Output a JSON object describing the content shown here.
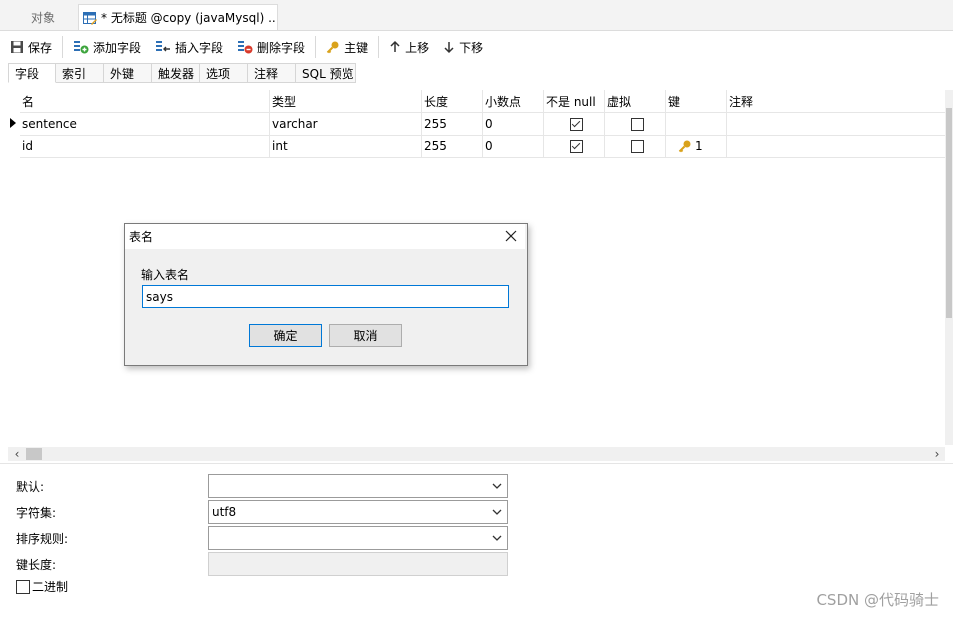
{
  "tabs": {
    "objects_label": "对象",
    "active_label": "* 无标题 @copy (javaMysql) ..."
  },
  "toolbar": {
    "save": "保存",
    "add_field": "添加字段",
    "insert_field": "插入字段",
    "delete_field": "删除字段",
    "primary_key": "主键",
    "move_up": "上移",
    "move_down": "下移"
  },
  "subtabs": [
    "字段",
    "索引",
    "外键",
    "触发器",
    "选项",
    "注释",
    "SQL 预览"
  ],
  "grid": {
    "headers": [
      "名",
      "类型",
      "长度",
      "小数点",
      "不是 null",
      "虚拟",
      "键",
      "注释"
    ],
    "rows": [
      {
        "name": "sentence",
        "type": "varchar",
        "length": "255",
        "decimal": "0",
        "not_null": true,
        "virtual": false,
        "key": "",
        "comment": ""
      },
      {
        "name": "id",
        "type": "int",
        "length": "255",
        "decimal": "0",
        "not_null": true,
        "virtual": false,
        "key": "1",
        "comment": ""
      }
    ]
  },
  "properties": {
    "default_label": "默认:",
    "default_value": "",
    "charset_label": "字符集:",
    "charset_value": "utf8",
    "collation_label": "排序规则:",
    "collation_value": "",
    "key_length_label": "键长度:",
    "binary_label": "二进制"
  },
  "dialog": {
    "title": "表名",
    "prompt": "输入表名",
    "input_value": "says",
    "ok": "确定",
    "cancel": "取消"
  },
  "watermark": "CSDN @代码骑士",
  "colors": {
    "accent": "#0078d7",
    "key_gold": "#d9a21b"
  }
}
